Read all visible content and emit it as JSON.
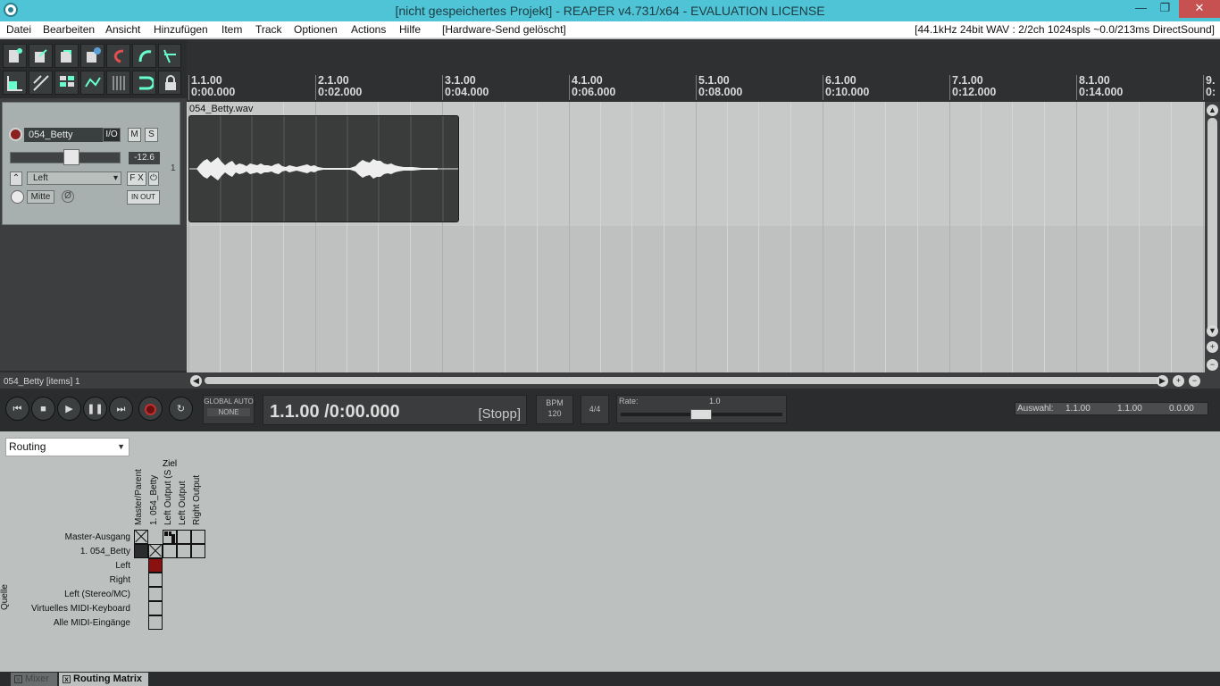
{
  "window": {
    "title": "[nicht gespeichertes Projekt] - REAPER v4.731/x64 - EVALUATION LICENSE",
    "minimize": "—",
    "restore": "❐",
    "close": "✕"
  },
  "menu": {
    "items": [
      "Datei",
      "Bearbeiten",
      "Ansicht",
      "Hinzufügen",
      "Item",
      "Track",
      "Optionen",
      "Actions",
      "Hilfe",
      "[Hardware-Send gelöscht]"
    ],
    "audio_status": "[44.1kHz 24bit WAV : 2/2ch 1024spls ~0.0/213ms DirectSound]"
  },
  "track": {
    "name": "054_Betty",
    "io_label": "I/O",
    "mute_label": "M",
    "solo_label": "S",
    "volume": "-12.6",
    "input": "Left",
    "fx_label": "F X",
    "pan": "Mitte",
    "phase": "Ø",
    "in_out_label": "IN OUT",
    "number": "1",
    "status": "054_Betty [items] 1"
  },
  "ruler": {
    "markers": [
      {
        "bar": "1.1.00",
        "time": "0:00.000"
      },
      {
        "bar": "2.1.00",
        "time": "0:02.000"
      },
      {
        "bar": "3.1.00",
        "time": "0:04.000"
      },
      {
        "bar": "4.1.00",
        "time": "0:06.000"
      },
      {
        "bar": "5.1.00",
        "time": "0:08.000"
      },
      {
        "bar": "6.1.00",
        "time": "0:10.000"
      },
      {
        "bar": "7.1.00",
        "time": "0:12.000"
      },
      {
        "bar": "8.1.00",
        "time": "0:14.000"
      },
      {
        "bar": "9.",
        "time": "0:"
      }
    ]
  },
  "item": {
    "name": "054_Betty.wav"
  },
  "transport": {
    "global_auto": "GLOBAL AUTO",
    "auto_mode": "NONE",
    "position": "1.1.00 /0:00.000",
    "state": "[Stopp]",
    "bpm_label": "BPM",
    "bpm": "120",
    "time_sig": "4/4",
    "rate_label": "Rate:",
    "rate_value": "1.0",
    "selection_label": "Auswahl:",
    "selection_start": "1.1.00",
    "selection_end": "1.1.00",
    "selection_length": "0.0.00"
  },
  "routing": {
    "view": "Routing",
    "target_header": "Ziel",
    "source_header": "Quelle",
    "columns": [
      "Master/Parent",
      "1. 054_Betty",
      "Left Output (S",
      "Left Output",
      "Right Output"
    ],
    "rows": [
      "Master-Ausgang",
      "1. 054_Betty",
      "Left",
      "Right",
      "Left (Stereo/MC)",
      "Virtuelles MIDI-Keyboard",
      "Alle MIDI-Eingänge"
    ]
  },
  "tabs": [
    {
      "label": "Mixer",
      "active": false
    },
    {
      "label": "Routing Matrix",
      "active": true
    }
  ],
  "colors": {
    "titlebar": "#4fc4d6",
    "record_arm": "#8a2020",
    "route_active": "#8b1010",
    "close_button": "#c75050"
  }
}
